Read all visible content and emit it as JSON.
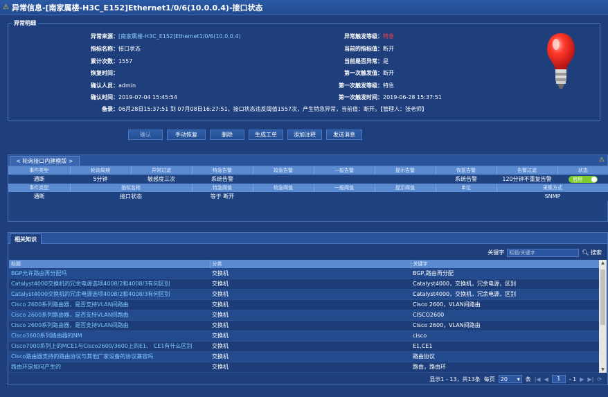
{
  "title": "异常信息-[南家属楼-H3C_E152]Ethernet1/0/6(10.0.0.4)-接口状态",
  "detail": {
    "legend": "异常明细",
    "fields": {
      "source_label": "异常来源：",
      "source_value": "[南家属楼-H3C_E152]Ethernet1/0/6(10.0.0.4)",
      "trigger_level_label": "异常触发等级：",
      "trigger_level_value": "特急",
      "metric_label": "指标名称：",
      "metric_value": "接口状态",
      "current_value_label": "当前的指标值：",
      "current_value_value": "断开",
      "count_label": "累计次数：",
      "count_value": "1557",
      "is_abnormal_label": "当前是否异常：",
      "is_abnormal_value": "是",
      "recover_label": "恢复时间：",
      "recover_value": "",
      "first_value_label": "第一次触发值：",
      "first_value_value": "断开",
      "confirm_label": "确认人员：",
      "confirm_value": "admin",
      "first_level_label": "第一次触发等级：",
      "first_level_value": "特急",
      "confirm_time_label": "确认时间：",
      "confirm_time_value": "2019-07-04 15:45:54",
      "first_time_label": "第一次触发时间：",
      "first_time_value": "2019-06-28 15:37:51",
      "remark_label": "备录：",
      "remark_value": "06月28日15:37:51 到 07月08日16:27:51，接口状态违反阈值1557次，产生特急异常，当前值：断开。【管理人：张老师】"
    },
    "icon": "lightbulb-icon",
    "alert_color": "#ff3030"
  },
  "buttons": {
    "confirm": "确认",
    "manual_recover": "手动恢复",
    "delete": "删除",
    "create_ticket": "生成工单",
    "add_note": "添加注释",
    "send_message": "发送消息"
  },
  "rule_panel": {
    "tab": "< 轮询接口内建模版 >",
    "head1": [
      "事件类型",
      "轮询周期",
      "异常过滤",
      "特急告警",
      "较急告警",
      "一般告警",
      "提示告警",
      "恢复告警",
      "告警过滤",
      "状态"
    ],
    "row1": [
      "通断",
      "5分钟",
      "敏感度三次",
      "系统告警",
      "",
      "",
      "",
      "系统告警",
      "120分钟不重复告警",
      ""
    ],
    "toggle_label": "启用",
    "head2": [
      "事件类型",
      "指标名称",
      "特急阈值",
      "较急阈值",
      "一般阈值",
      "提示阈值",
      "单位",
      "采集方式"
    ],
    "row2": [
      "通断",
      "接口状态",
      "等于 断开",
      "",
      "",
      "",
      "",
      "SNMP"
    ]
  },
  "knowledge": {
    "tab": "相关知识",
    "search_label": "关键字",
    "search_placeholder": "标题/关键字",
    "search_button": "搜索",
    "columns": [
      "标题",
      "分类",
      "关键字"
    ],
    "rows": [
      [
        "BGP允许路由再分配吗",
        "交换机",
        "BGP,路由再分配"
      ],
      [
        "Catalyst4000交换机的冗余电源选项4008/2和4008/3有何区别",
        "交换机",
        "Catalyst4000，交换机，冗余电源，区别"
      ],
      [
        "Catalyst4000交换机的冗余电源选项4008/2和4008/3有何区别",
        "交换机",
        "Catalyst4000，交换机，冗余电源，区别"
      ],
      [
        "Cisco 2600系列路由器，是否支持VLAN间路由",
        "交换机",
        "Cisco 2600，VLAN间路由"
      ],
      [
        "Cisco 2600系列路由器，是否支持VLAN间路由",
        "交换机",
        "CISCO2600"
      ],
      [
        "Cisco 2600系列路由器，是否支持VLAN间路由",
        "交换机",
        "Cisco 2600，VLAN间路由"
      ],
      [
        "Cisco3600系列路由器的NM",
        "交换机",
        "cisco"
      ],
      [
        "Cisco7000系列上的MCE1与Cisco2600/3600上的E1、 CE1有什么区别",
        "交换机",
        "E1,CE1"
      ],
      [
        "Cisco路由器支持的路由协议与其他厂家设备的协议兼容吗",
        "交换机",
        "路由协议"
      ],
      [
        "路由环是如何产生的",
        "交换机",
        "路由，路由环"
      ]
    ],
    "pager": {
      "summary": "显示1 - 13，共13条",
      "per_page_label": "每页",
      "per_page": "20",
      "unit": "条",
      "page": "1",
      "total": "- 1"
    }
  }
}
